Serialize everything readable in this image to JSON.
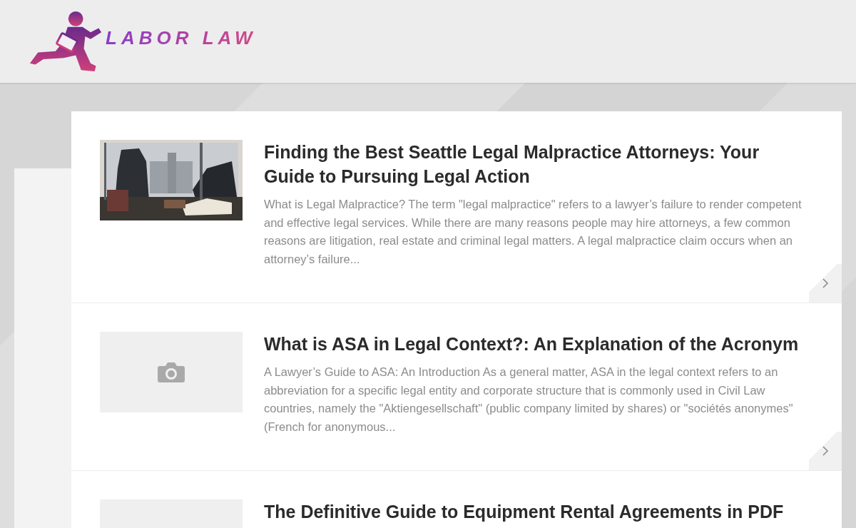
{
  "logo": {
    "text": "LABOR LAW"
  },
  "articles": [
    {
      "title": "Finding the Best Seattle Legal Malpractice Attorneys: Your Guide to Pursuing Legal Action",
      "excerpt": "What is Legal Malpractice? The term \"legal malpractice\" refers to a lawyer’s failure to render competent and effective legal services. While there are many reasons people may hire attorneys, a few common reasons are litigation, real estate and criminal legal matters. A legal malpractice claim occurs when an attorney’s failure..."
    },
    {
      "thumbnail": {
        "kind": "placeholder"
      },
      "title": "What is ASA in Legal Context?: An Explanation of the Acronym",
      "excerpt": "A Lawyer’s Guide to ASA: An Introduction As a general matter, ASA in the legal context refers to an abbreviation for a specific legal entity and corporate structure that is commonly used in Civil Law countries, namely the \"Aktiengesellschaft\" (public company limited by shares) or \"sociétés anonymes\" (French for anonymous..."
    },
    {
      "thumbnail": {
        "kind": "blank"
      },
      "title": "The Definitive Guide to Equipment Rental Agreements in PDF"
    }
  ]
}
